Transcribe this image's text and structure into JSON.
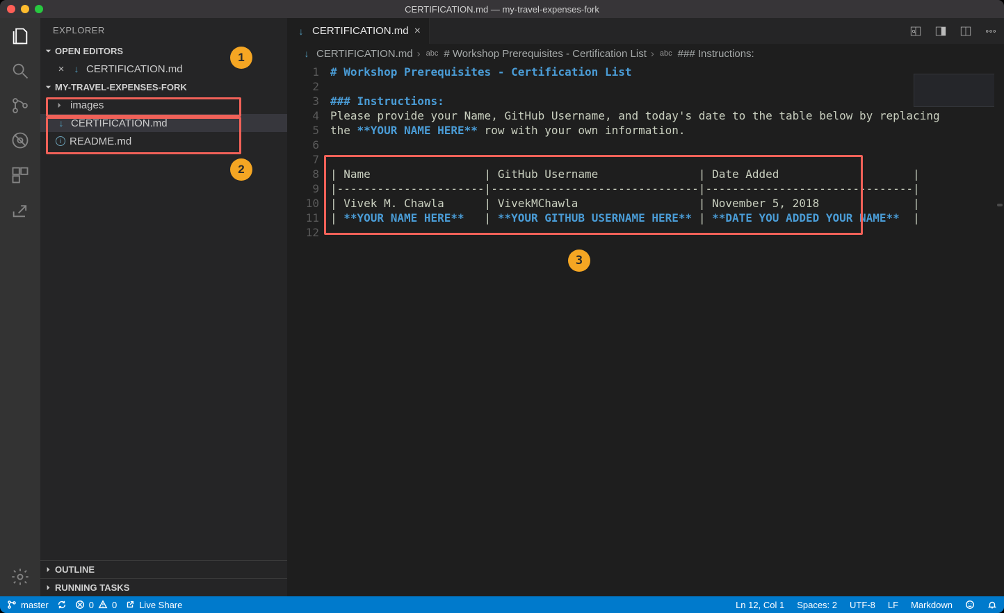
{
  "window": {
    "title": "CERTIFICATION.md — my-travel-expenses-fork"
  },
  "sidebar": {
    "title": "EXPLORER",
    "openEditorsLabel": "OPEN EDITORS",
    "openEditors": [
      {
        "name": "CERTIFICATION.md"
      }
    ],
    "projectLabel": "MY-TRAVEL-EXPENSES-FORK",
    "tree": {
      "images": "images",
      "certification": "CERTIFICATION.md",
      "readme": "README.md"
    },
    "outlineLabel": "OUTLINE",
    "runningTasksLabel": "RUNNING TASKS"
  },
  "tab": {
    "name": "CERTIFICATION.md"
  },
  "breadcrumbs": {
    "file": "CERTIFICATION.md",
    "h1": "# Workshop Prerequisites - Certification List",
    "h3": "### Instructions:"
  },
  "editor": {
    "ln": [
      "1",
      "2",
      "3",
      "4",
      "5",
      "6",
      "7",
      "8",
      "9",
      "10",
      "11",
      "12"
    ],
    "l1": "# Workshop Prerequisites - Certification List",
    "l3": "### Instructions:",
    "l4": "Please provide your Name, GitHub Username, and today's date to the table below by replacing",
    "l5a": "the ",
    "l5b": "**YOUR NAME HERE**",
    "l5c": " row with your own information.",
    "l8": "| Name                 | GitHub Username               | Date Added                    |",
    "l9": "|----------------------|-------------------------------|-------------------------------|",
    "l10": "| Vivek M. Chawla      | VivekMChawla                  | November 5, 2018              |",
    "l11a": "| ",
    "l11b": "**YOUR NAME HERE**",
    "l11c": "   | ",
    "l11d": "**YOUR GITHUB USERNAME HERE**",
    "l11e": " | ",
    "l11f": "**DATE YOU ADDED YOUR NAME**",
    "l11g": "  |"
  },
  "callouts": {
    "one": "1",
    "two": "2",
    "three": "3"
  },
  "statusbar": {
    "branch": "master",
    "errors": "0",
    "warnings": "0",
    "liveShare": "Live Share",
    "lineCol": "Ln 12, Col 1",
    "spaces": "Spaces: 2",
    "encoding": "UTF-8",
    "eol": "LF",
    "lang": "Markdown"
  }
}
